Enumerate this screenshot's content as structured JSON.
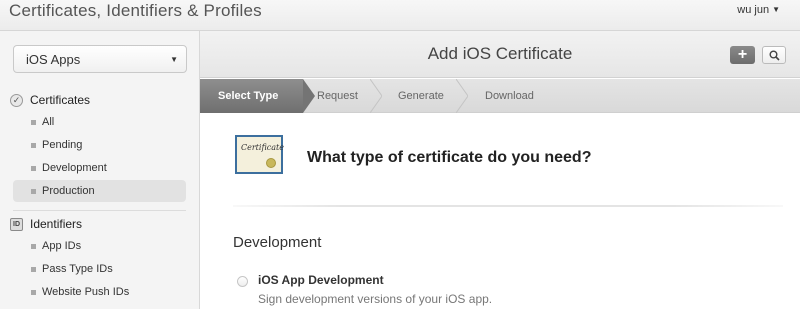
{
  "app": {
    "title": "Certificates, Identifiers & Profiles"
  },
  "user": {
    "name": "wu jun"
  },
  "sidebar": {
    "platform_select": "iOS Apps",
    "certificates": {
      "heading": "Certificates",
      "items": [
        {
          "label": "All"
        },
        {
          "label": "Pending"
        },
        {
          "label": "Development"
        },
        {
          "label": "Production",
          "active": true
        }
      ]
    },
    "identifiers": {
      "heading": "Identifiers",
      "icon_text": "ID",
      "items": [
        {
          "label": "App IDs"
        },
        {
          "label": "Pass Type IDs"
        },
        {
          "label": "Website Push IDs"
        }
      ]
    }
  },
  "main": {
    "title": "Add iOS Certificate",
    "add_label": "+",
    "steps": [
      {
        "label": "Select Type",
        "active": true
      },
      {
        "label": "Request"
      },
      {
        "label": "Generate"
      },
      {
        "label": "Download"
      }
    ],
    "certificate_icon_text": "Certificate",
    "question": "What type of certificate do you need?",
    "section_title": "Development",
    "option": {
      "title": "iOS App Development",
      "description": "Sign development versions of your iOS app."
    }
  },
  "colors": {
    "active_step_bg": "#7d7d7d",
    "cert_border": "#3c6f9e",
    "sidebar_bg": "#f4f4f4"
  },
  "icons": [
    "caret-down-icon",
    "certificate-check-icon",
    "id-icon",
    "plus-icon",
    "search-icon",
    "certificate-icon",
    "radio-icon"
  ]
}
